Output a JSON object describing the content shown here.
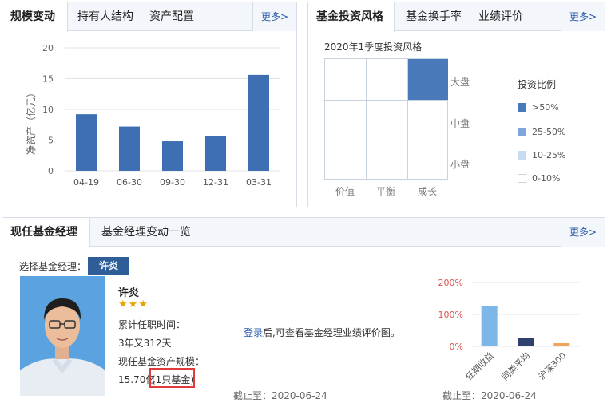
{
  "scale_panel": {
    "tabs": [
      "规模变动",
      "持有人结构",
      "资产配置"
    ],
    "more": "更多>",
    "chart_data": {
      "type": "bar",
      "title": "",
      "xlabel": "",
      "ylabel": "净资产（亿元）",
      "categories": [
        "04-19",
        "06-30",
        "09-30",
        "12-31",
        "03-31"
      ],
      "values": [
        9.2,
        7.2,
        4.8,
        5.6,
        15.6
      ],
      "ylim": [
        0,
        20
      ],
      "yticks": [
        "0",
        "5",
        "10",
        "15",
        "20"
      ],
      "color": "#3d6fb2"
    }
  },
  "style_panel": {
    "tabs": [
      "基金投资风格",
      "基金换手率",
      "业绩评价"
    ],
    "more": "更多>",
    "box_title": "2020年1季度投资风格",
    "col_labels": [
      "价值",
      "平衡",
      "成长"
    ],
    "row_labels": [
      "大盘",
      "中盘",
      "小盘"
    ],
    "highlight": {
      "row": "大盘",
      "col": "成长",
      "level": ">50%"
    },
    "legend_title": "投资比例",
    "legend": [
      {
        "label": ">50%",
        "color": "#4a79b9"
      },
      {
        "label": "25-50%",
        "color": "#7ea6d9"
      },
      {
        "label": "10-25%",
        "color": "#c7dbf1"
      },
      {
        "label": "0-10%",
        "color": "#ffffff"
      }
    ]
  },
  "manager_panel": {
    "tabs": [
      "现任基金经理",
      "基金经理变动一览"
    ],
    "more": "更多>",
    "select_label": "选择基金经理：",
    "manager_button": "许炎",
    "name": "许炎",
    "stars": "★★★",
    "tenure_label": "累计任职时间：",
    "tenure_value": "3年又312天",
    "aum_label": "现任基金资产规模：",
    "aum_value": "15.70亿",
    "aum_funds": "(1只基金)",
    "login_link": "登录",
    "login_text": "后,可查看基金经理业绩评价图。",
    "as_of_left": "截止至：2020-06-24",
    "as_of_right": "截止至：2020-06-24",
    "chart_data": {
      "type": "bar",
      "title": "",
      "categories": [
        "任期收益",
        "同类平均",
        "沪深300"
      ],
      "values": [
        125,
        25,
        10
      ],
      "ylim": [
        0,
        200
      ],
      "yticks": [
        "0%",
        "100%",
        "200%"
      ],
      "colors": [
        "#7db6e8",
        "#2f3f6e",
        "#f0a35a"
      ]
    }
  }
}
